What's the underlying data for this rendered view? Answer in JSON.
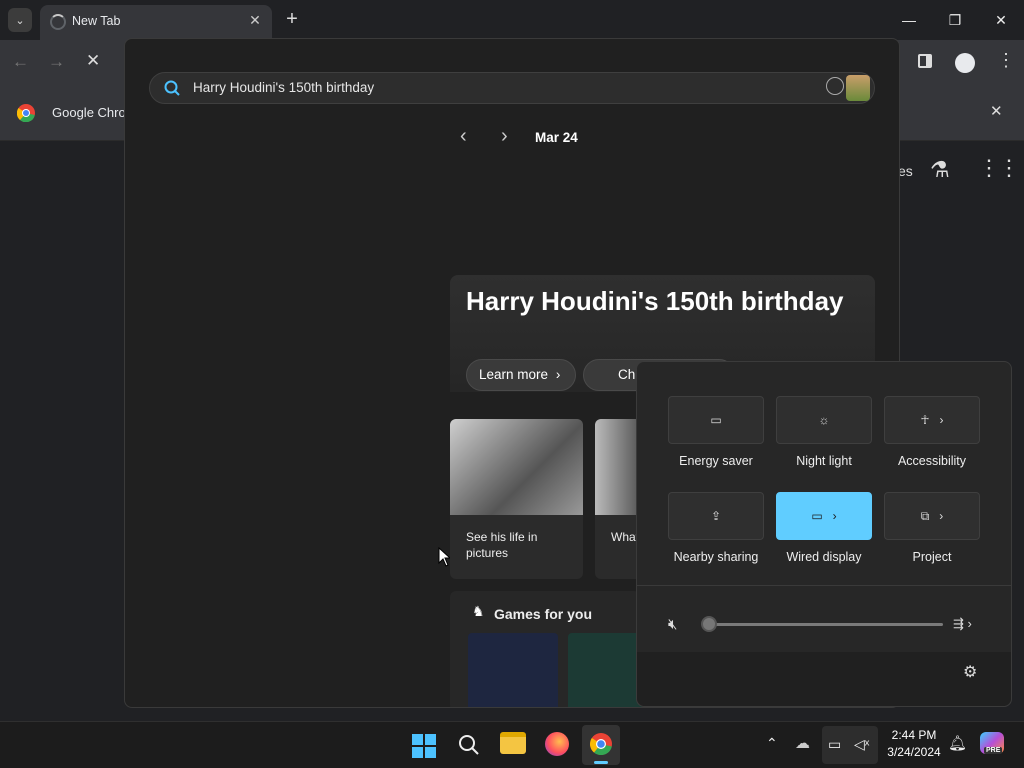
{
  "browser": {
    "tab_title": "New Tab",
    "tab_close": "✕",
    "new_tab": "+",
    "bookmark_label": "Google Chro",
    "partial_label": "es",
    "window_controls": {
      "minimize": "—",
      "maximize": "❐",
      "close": "✕"
    }
  },
  "search": {
    "query": "Harry Houdini's 150th birthday",
    "date": "Mar 24",
    "hero_title": "Harry Houdini's 150th birthday",
    "learn_more": "Learn more",
    "second_pill": "Ch",
    "cards": [
      {
        "label": "See his life in pictures"
      },
      {
        "label": "What's great"
      }
    ],
    "games_title": "Games for you"
  },
  "quick_settings": {
    "tiles": [
      {
        "label": "Energy saver",
        "icon": "battery-leaf-icon",
        "active": false
      },
      {
        "label": "Night light",
        "icon": "sun-icon",
        "active": false
      },
      {
        "label": "Accessibility",
        "icon": "accessibility-icon",
        "active": false
      },
      {
        "label": "Nearby sharing",
        "icon": "share-icon",
        "active": false
      },
      {
        "label": "Wired display",
        "icon": "cast-icon",
        "active": true
      },
      {
        "label": "Project",
        "icon": "project-icon",
        "active": false
      }
    ],
    "volume_level": 0,
    "volume_muted": true,
    "accent": "#60cdff"
  },
  "taskbar": {
    "time": "2:44 PM",
    "date": "3/24/2024",
    "copilot_badge": "PRE"
  }
}
